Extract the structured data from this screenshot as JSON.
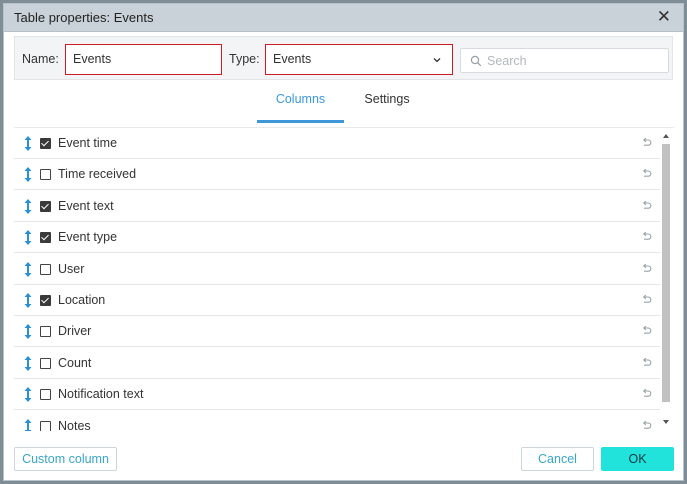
{
  "dialog": {
    "title": "Table properties: Events",
    "close_glyph": "✕"
  },
  "form": {
    "name_label": "Name:",
    "name_value": "Events",
    "type_label": "Type:",
    "type_value": "Events",
    "search_placeholder": "Search"
  },
  "tabs": [
    {
      "label": "Columns",
      "active": true
    },
    {
      "label": "Settings",
      "active": false
    }
  ],
  "columns": [
    {
      "label": "Event time",
      "checked": true
    },
    {
      "label": "Time received",
      "checked": false
    },
    {
      "label": "Event text",
      "checked": true
    },
    {
      "label": "Event type",
      "checked": true
    },
    {
      "label": "User",
      "checked": false
    },
    {
      "label": "Location",
      "checked": true
    },
    {
      "label": "Driver",
      "checked": false
    },
    {
      "label": "Count",
      "checked": false
    },
    {
      "label": "Notification text",
      "checked": false
    },
    {
      "label": "Notes",
      "checked": false
    }
  ],
  "footer": {
    "custom_label": "Custom column",
    "cancel_label": "Cancel",
    "ok_label": "OK"
  },
  "icons": {
    "drag": "drag-handle-icon",
    "reset": "undo-icon",
    "search": "search-icon",
    "dropdown": "chevron-down-icon",
    "close": "close-icon"
  },
  "colors": {
    "accent": "#3d97d9",
    "drag_icon": "#2b8fd0",
    "ok_button": "#22e2dc",
    "field_border": "#cc1b24",
    "titlebar": "#c9d2d8"
  }
}
